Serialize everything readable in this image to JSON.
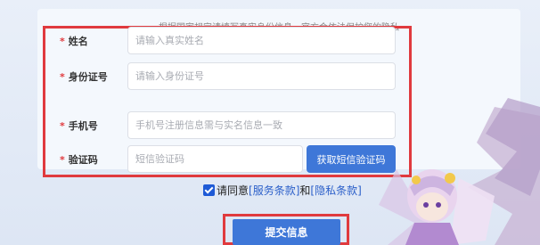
{
  "notice": "根据国家规定请填写真实身份信息，官方会依法保护您的隐私",
  "form": {
    "name": {
      "label": "姓名",
      "placeholder": "请输入真实姓名"
    },
    "id_number": {
      "label": "身份证号",
      "placeholder": "请输入身份证号"
    },
    "phone": {
      "label": "手机号",
      "placeholder": "手机号注册信息需与实名信息一致"
    },
    "code": {
      "label": "验证码",
      "placeholder": "短信验证码",
      "button": "获取短信验证码"
    },
    "required_mark": "*"
  },
  "agreement": {
    "prefix": "请同意",
    "service_link": "[服务条款]",
    "conjunction": "和",
    "privacy_link": "[隐私条款]"
  },
  "submit_label": "提交信息",
  "colors": {
    "accent": "#3e77d8",
    "highlight": "#e03a3e"
  }
}
